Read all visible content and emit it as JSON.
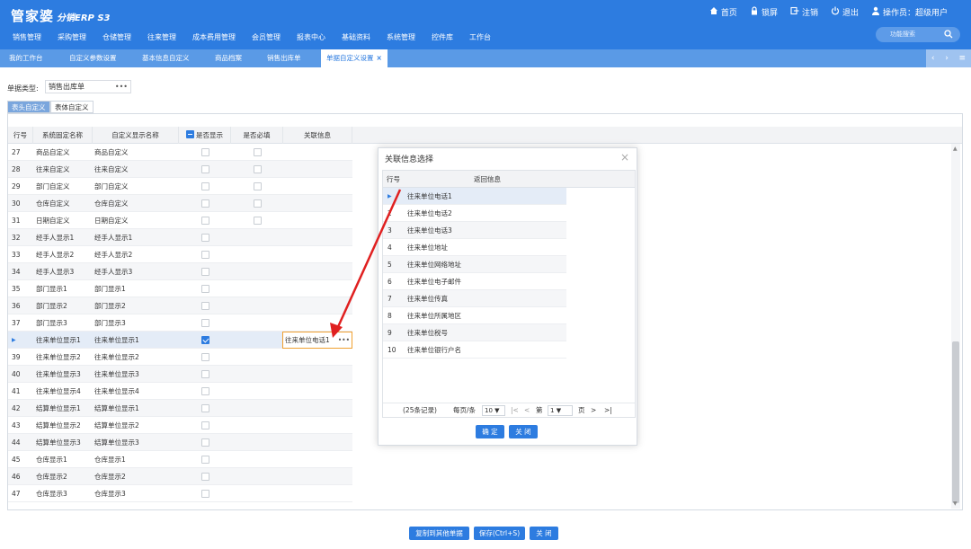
{
  "app": {
    "logo": "管家婆",
    "logo_sub": "分销ERP S3"
  },
  "toplinks": [
    {
      "icon": "home-icon",
      "label": "首页"
    },
    {
      "icon": "lock-icon",
      "label": "锁屏"
    },
    {
      "icon": "logout-icon",
      "label": "注销"
    },
    {
      "icon": "power-icon",
      "label": "退出"
    },
    {
      "icon": "user-icon",
      "label": "操作员：超级用户"
    }
  ],
  "nav": [
    "销售管理",
    "采购管理",
    "仓储管理",
    "往来管理",
    "成本费用管理",
    "会员管理",
    "报表中心",
    "基础资料",
    "系统管理",
    "控件库",
    "工作台"
  ],
  "search": {
    "placeholder": "功能搜索",
    "icon": "search-icon"
  },
  "tabs": [
    "我的工作台",
    "自定义参数设置",
    "基本信息自定义",
    "商品档案",
    "销售出库单",
    "单据自定义设置"
  ],
  "active_tab": 5,
  "doc_type": {
    "label": "单据类型:",
    "value": "销售出库单"
  },
  "subtabs": {
    "header": "表头自定义",
    "body": "表体自定义"
  },
  "grid": {
    "columns": [
      "行号",
      "系统固定名称",
      "自定义显示名称",
      "是否显示",
      "是否必填",
      "关联信息"
    ],
    "rows": [
      {
        "no": "27",
        "sys": "商品自定义",
        "disp": "商品自定义",
        "show": false,
        "req": false,
        "link": ""
      },
      {
        "no": "28",
        "sys": "往来自定义",
        "disp": "往来自定义",
        "show": false,
        "req": false,
        "link": ""
      },
      {
        "no": "29",
        "sys": "部门自定义",
        "disp": "部门自定义",
        "show": false,
        "req": false,
        "link": ""
      },
      {
        "no": "30",
        "sys": "仓库自定义",
        "disp": "仓库自定义",
        "show": false,
        "req": false,
        "link": ""
      },
      {
        "no": "31",
        "sys": "日期自定义",
        "disp": "日期自定义",
        "show": false,
        "req": false,
        "link": ""
      },
      {
        "no": "32",
        "sys": "经手人显示1",
        "disp": "经手人显示1",
        "show": false,
        "req": null,
        "link": ""
      },
      {
        "no": "33",
        "sys": "经手人显示2",
        "disp": "经手人显示2",
        "show": false,
        "req": null,
        "link": ""
      },
      {
        "no": "34",
        "sys": "经手人显示3",
        "disp": "经手人显示3",
        "show": false,
        "req": null,
        "link": ""
      },
      {
        "no": "35",
        "sys": "部门显示1",
        "disp": "部门显示1",
        "show": false,
        "req": null,
        "link": ""
      },
      {
        "no": "36",
        "sys": "部门显示2",
        "disp": "部门显示2",
        "show": false,
        "req": null,
        "link": ""
      },
      {
        "no": "37",
        "sys": "部门显示3",
        "disp": "部门显示3",
        "show": false,
        "req": null,
        "link": ""
      },
      {
        "no": "▶",
        "sys": "往来单位显示1",
        "disp": "往来单位显示1",
        "show": true,
        "req": null,
        "link": "往来单位电话1"
      },
      {
        "no": "39",
        "sys": "往来单位显示2",
        "disp": "往来单位显示2",
        "show": false,
        "req": null,
        "link": ""
      },
      {
        "no": "40",
        "sys": "往来单位显示3",
        "disp": "往来单位显示3",
        "show": false,
        "req": null,
        "link": ""
      },
      {
        "no": "41",
        "sys": "往来单位显示4",
        "disp": "往来单位显示4",
        "show": false,
        "req": null,
        "link": ""
      },
      {
        "no": "42",
        "sys": "结算单位显示1",
        "disp": "结算单位显示1",
        "show": false,
        "req": null,
        "link": ""
      },
      {
        "no": "43",
        "sys": "结算单位显示2",
        "disp": "结算单位显示2",
        "show": false,
        "req": null,
        "link": ""
      },
      {
        "no": "44",
        "sys": "结算单位显示3",
        "disp": "结算单位显示3",
        "show": false,
        "req": null,
        "link": ""
      },
      {
        "no": "45",
        "sys": "仓库显示1",
        "disp": "仓库显示1",
        "show": false,
        "req": null,
        "link": ""
      },
      {
        "no": "46",
        "sys": "仓库显示2",
        "disp": "仓库显示2",
        "show": false,
        "req": null,
        "link": ""
      },
      {
        "no": "47",
        "sys": "仓库显示3",
        "disp": "仓库显示3",
        "show": false,
        "req": null,
        "link": ""
      }
    ]
  },
  "dialog": {
    "title": "关联信息选择",
    "columns": [
      "行号",
      "返回信息"
    ],
    "rows": [
      {
        "no": "▶",
        "info": "往来单位电话1"
      },
      {
        "no": "2",
        "info": "往来单位电话2"
      },
      {
        "no": "3",
        "info": "往来单位电话3"
      },
      {
        "no": "4",
        "info": "往来单位地址"
      },
      {
        "no": "5",
        "info": "往来单位网络地址"
      },
      {
        "no": "6",
        "info": "往来单位电子邮件"
      },
      {
        "no": "7",
        "info": "往来单位传真"
      },
      {
        "no": "8",
        "info": "往来单位所属地区"
      },
      {
        "no": "9",
        "info": "往来单位税号"
      },
      {
        "no": "10",
        "info": "往来单位银行户名"
      }
    ],
    "pager": {
      "records": "(25条记录)",
      "per_page_label": "每页/条",
      "per_page": "10",
      "page_prefix": "第",
      "page": "1",
      "page_suffix": "页"
    },
    "ok": "确 定",
    "close": "关 闭"
  },
  "footer": {
    "copy": "复制到其他单据",
    "save": "保存(Ctrl+S)",
    "close": "关 闭"
  },
  "colors": {
    "brand": "#2d7ce0",
    "highlight": "#f0a030",
    "arrow": "#e02020"
  }
}
